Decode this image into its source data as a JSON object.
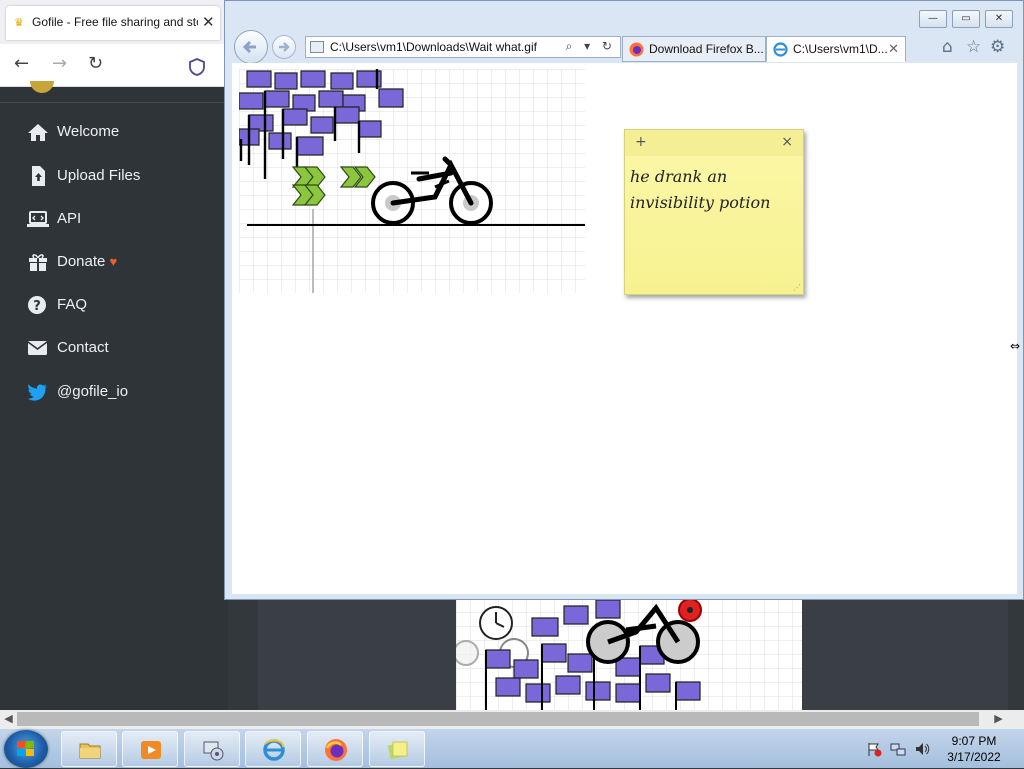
{
  "firefox": {
    "tab_title": "Gofile - Free file sharing and sto",
    "tab_close": "✕",
    "nav": {
      "back": "←",
      "forward": "→",
      "reload": "↻"
    }
  },
  "sidebar": {
    "items": [
      {
        "label": "Welcome",
        "icon": "home-icon"
      },
      {
        "label": "Upload Files",
        "icon": "file-upload-icon"
      },
      {
        "label": "API",
        "icon": "laptop-code-icon"
      },
      {
        "label": "Donate",
        "icon": "gift-icon",
        "extra": "♥"
      },
      {
        "label": "FAQ",
        "icon": "question-circle-icon"
      },
      {
        "label": "Contact",
        "icon": "envelope-icon"
      },
      {
        "label": "@gofile_io",
        "icon": "twitter-icon"
      }
    ]
  },
  "ie": {
    "window_buttons": {
      "minimize": "—",
      "maximize": "▭",
      "close": "✕"
    },
    "address": "C:\\Users\\vm1\\Downloads\\Wait what.gif",
    "address_tools": "⌕ ▾ ↻",
    "tabs": [
      {
        "label": "Download Firefox B...",
        "icon": "firefox-icon",
        "active": false
      },
      {
        "label": "C:\\Users\\vm1\\D...",
        "icon": "ie-icon",
        "active": true,
        "close": "✕"
      }
    ],
    "toolbar": {
      "home": "⌂",
      "favorites": "☆",
      "settings": "⚙"
    }
  },
  "sticky_note": {
    "add": "+",
    "close": "×",
    "text_line1": "he drank an",
    "text_line2": "invisibility potion"
  },
  "taskbar": {
    "apps": [
      "file-explorer-icon",
      "media-player-icon",
      "devices-icon",
      "internet-explorer-icon",
      "firefox-icon",
      "sticky-notes-icon"
    ]
  },
  "clock": {
    "time": "9:07 PM",
    "date": "3/17/2022"
  },
  "colors": {
    "sidebar_bg": "#2f3439",
    "flag_purple": "#7b68d8",
    "chevron_green": "#8cc63f",
    "sticky_yellow": "#fbf7a8",
    "twitter_blue": "#1da1f2",
    "heart_orange": "#e8632b"
  }
}
